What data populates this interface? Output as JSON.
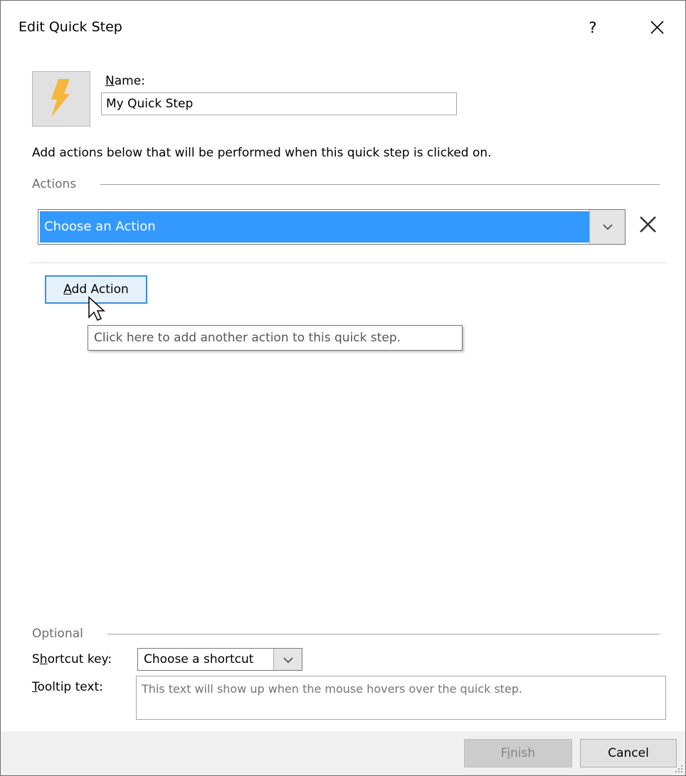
{
  "window": {
    "title": "Edit Quick Step",
    "help_label": "?",
    "close_icon": "close-icon"
  },
  "name_field": {
    "label": "Name:",
    "label_accesskey": "N",
    "label_rest": "ame:",
    "value": "My Quick Step",
    "icon": "lightning-bolt-icon",
    "icon_color": "#f6b73c"
  },
  "instructions": "Add actions below that will be performed when this quick step is clicked on.",
  "actions_group": {
    "label": "Actions",
    "selected_action": "Choose an Action",
    "selection_color": "#3399ff",
    "remove_icon": "remove-action-icon",
    "add_action_label_before": "",
    "add_action_accesskey": "A",
    "add_action_label_rest": "dd Action",
    "add_action_tooltip": "Click here to add another action to this quick step."
  },
  "optional_group": {
    "label": "Optional",
    "shortcut_label_before": "S",
    "shortcut_accesskey": "h",
    "shortcut_label_rest": "ortcut key:",
    "shortcut_value": "Choose a shortcut",
    "tooltip_label_accesskey": "T",
    "tooltip_label_rest": "ooltip text:",
    "tooltip_placeholder": "This text will show up when the mouse hovers over the quick step."
  },
  "footer": {
    "finish_before": "F",
    "finish_accesskey": "i",
    "finish_rest": "nish",
    "finish_enabled": false,
    "cancel_label": "Cancel"
  }
}
